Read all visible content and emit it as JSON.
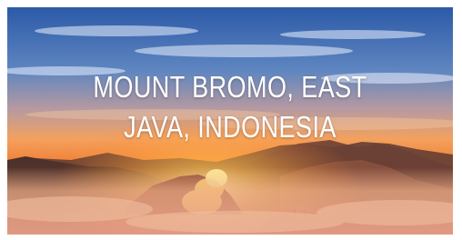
{
  "image": {
    "caption": {
      "line1": "MOUNT BROMO, EAST",
      "line2": "JAVA, INDONESIA"
    },
    "colors": {
      "sky_top": "#2f5fae",
      "sky_mid": "#6f93c4",
      "horizon": "#f08a3a",
      "sunglow": "#ffd36a",
      "ridge_dark": "#3a2a2a",
      "mist": "#e9a47b",
      "crater": "#b4643c"
    }
  }
}
